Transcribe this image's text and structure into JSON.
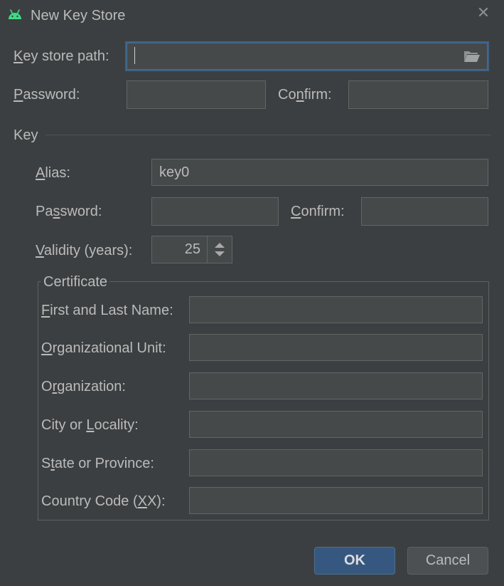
{
  "dialog": {
    "title": "New Key Store",
    "close_glyph": "✕",
    "app_icon": "android-icon"
  },
  "keystore": {
    "path_label_u": "K",
    "path_label_rest": "ey store path:",
    "path_value": "",
    "folder_icon": "folder-open-icon",
    "password_label_u": "P",
    "password_label_rest": "assword:",
    "confirm_label_pre": "Co",
    "confirm_label_u": "n",
    "confirm_label_post": "firm:"
  },
  "key": {
    "section_label": "Key",
    "alias_label_u": "A",
    "alias_label_rest": "lias:",
    "alias_value": "key0",
    "password_label_pre": "Pa",
    "password_label_u": "s",
    "password_label_post": "sword:",
    "confirm_label_u": "C",
    "confirm_label_rest": "onfirm:",
    "validity_label_u": "V",
    "validity_label_rest": "alidity (years):",
    "validity_value": "25"
  },
  "certificate": {
    "title": "Certificate",
    "fields": [
      {
        "pre": "",
        "u": "F",
        "post": "irst and Last Name:",
        "value": ""
      },
      {
        "pre": "",
        "u": "O",
        "post": "rganizational Unit:",
        "value": ""
      },
      {
        "pre": "O",
        "u": "r",
        "post": "ganization:",
        "value": ""
      },
      {
        "pre": "City or ",
        "u": "L",
        "post": "ocality:",
        "value": ""
      },
      {
        "pre": "S",
        "u": "t",
        "post": "ate or Province:",
        "value": ""
      },
      {
        "pre": "Country Code (",
        "u": "X",
        "post": "X):",
        "value": ""
      }
    ]
  },
  "buttons": {
    "ok": "OK",
    "cancel": "Cancel"
  },
  "colors": {
    "background": "#3c3f41",
    "field": "#45494a",
    "focus_border": "#3d6185",
    "ok_button": "#365880",
    "android_green": "#3ddc84"
  }
}
